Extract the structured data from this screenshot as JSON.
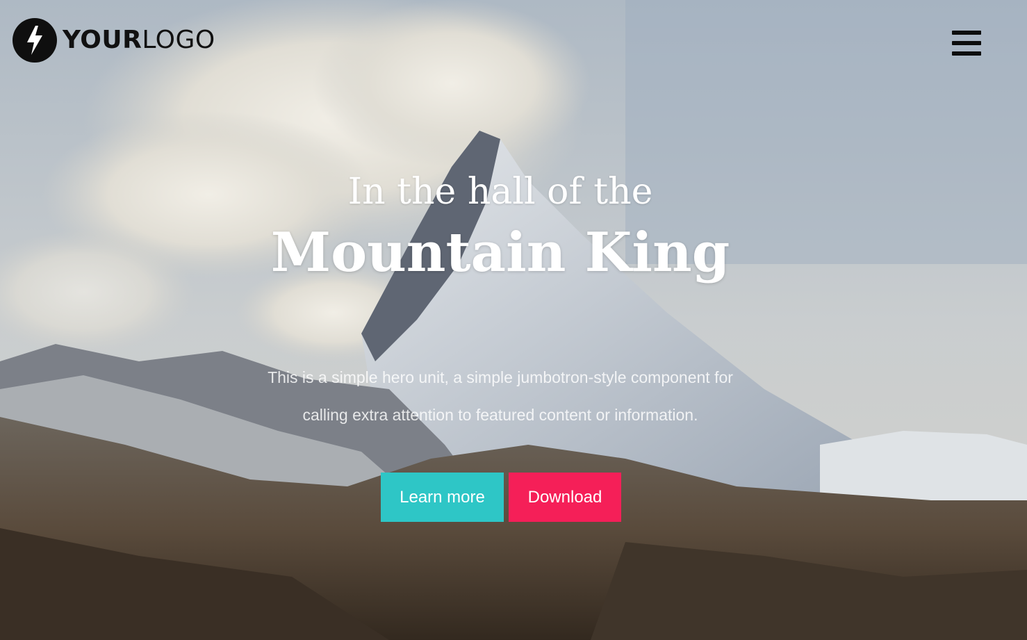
{
  "header": {
    "logo_bold": "YOUR",
    "logo_light": "LOGO",
    "logo_icon": "lightning-bolt-icon",
    "menu_icon": "hamburger-menu-icon"
  },
  "hero": {
    "kicker": "In the hall of the",
    "title": "Mountain King",
    "lead_line1": "This is a simple hero unit, a simple jumbotron-style component for",
    "lead_line2": "calling extra attention to featured content or information.",
    "background_icon": "mountain-photo"
  },
  "buttons": {
    "learn_more": "Learn more",
    "download": "Download"
  },
  "colors": {
    "learn_more_bg": "#2ec6c6",
    "download_bg": "#f51f58",
    "logo_dark": "#0f0f0f",
    "text_light": "#ffffff"
  }
}
